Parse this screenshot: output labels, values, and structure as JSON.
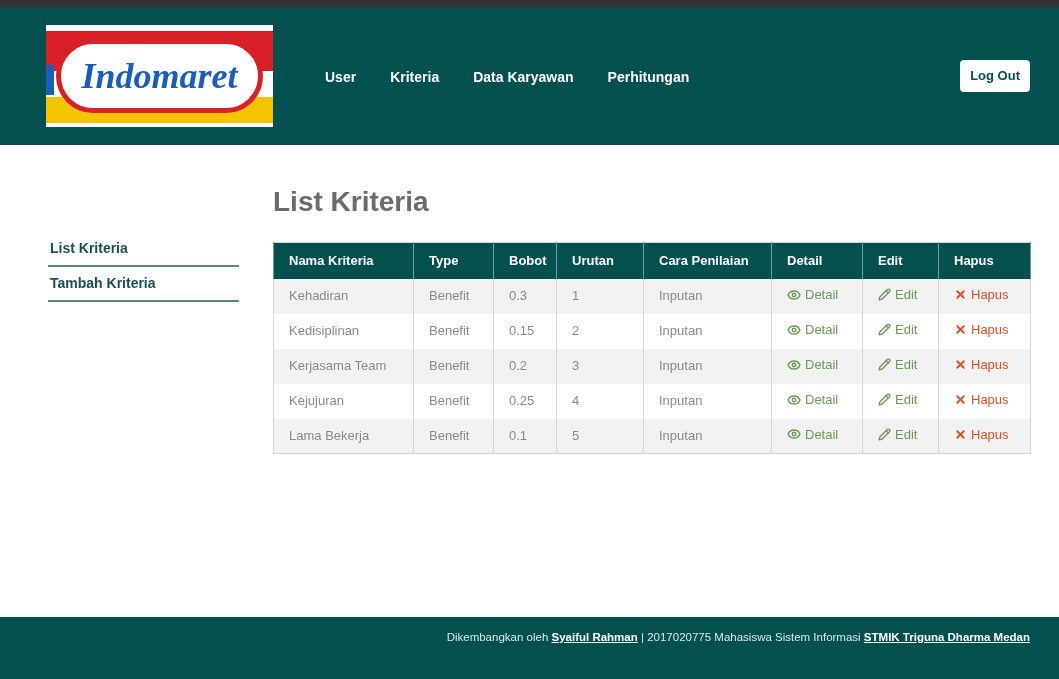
{
  "logo": {
    "text": "Indomaret"
  },
  "nav": {
    "items": [
      "User",
      "Kriteria",
      "Data Karyawan",
      "Perhitungan"
    ],
    "logout": "Log Out"
  },
  "sidebar": {
    "items": [
      "List Kriteria",
      "Tambah Kriteria"
    ]
  },
  "page_title": "List Kriteria",
  "table": {
    "columns": [
      "Nama Kriteria",
      "Type",
      "Bobot",
      "Urutan",
      "Cara Penilaian",
      "Detail",
      "Edit",
      "Hapus"
    ],
    "rows": [
      {
        "cells": [
          "Kehadiran",
          "Benefit",
          "0.3",
          "1",
          "Inputan"
        ],
        "detail": "Detail",
        "edit": "Edit",
        "delete": "Hapus"
      },
      {
        "cells": [
          "Kedisiplinan",
          "Benefit",
          "0.15",
          "2",
          "Inputan"
        ],
        "detail": "Detail",
        "edit": "Edit",
        "delete": "Hapus"
      },
      {
        "cells": [
          "Kerjasama Team",
          "Benefit",
          "0.2",
          "3",
          "Inputan"
        ],
        "detail": "Detail",
        "edit": "Edit",
        "delete": "Hapus"
      },
      {
        "cells": [
          "Kejujuran",
          "Benefit",
          "0.25",
          "4",
          "Inputan"
        ],
        "detail": "Detail",
        "edit": "Edit",
        "delete": "Hapus"
      },
      {
        "cells": [
          "Lama Bekerja",
          "Benefit",
          "0.1",
          "5",
          "Inputan"
        ],
        "detail": "Detail",
        "edit": "Edit",
        "delete": "Hapus"
      }
    ]
  },
  "footer": {
    "prefix": "Dikembangkan oleh",
    "author_link": "Syaiful Rahman",
    "middle": "| 2017020775 Mahasiswa Sistem Informasi",
    "institution_link": "STMIK Triguna Dharma Medan"
  }
}
